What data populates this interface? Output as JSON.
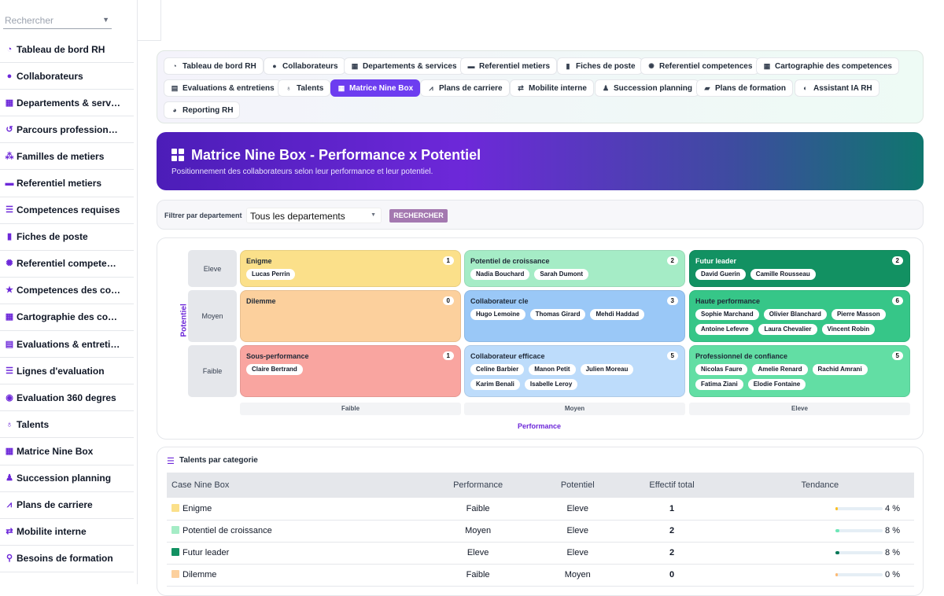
{
  "sidebar": {
    "search_placeholder": "Rechercher",
    "items": [
      {
        "label": "Tableau de bord RH",
        "icon": "gauge-icon"
      },
      {
        "label": "Collaborateurs",
        "icon": "user-icon"
      },
      {
        "label": "Departements & serv…",
        "icon": "building-icon"
      },
      {
        "label": "Parcours profession…",
        "icon": "history-icon"
      },
      {
        "label": "Familles de metiers",
        "icon": "sitemap-icon"
      },
      {
        "label": "Referentiel metiers",
        "icon": "briefcase-icon"
      },
      {
        "label": "Competences requises",
        "icon": "list-icon"
      },
      {
        "label": "Fiches de poste",
        "icon": "file-icon"
      },
      {
        "label": "Referentiel compete…",
        "icon": "gear-icon"
      },
      {
        "label": "Competences des co…",
        "icon": "star-icon"
      },
      {
        "label": "Cartographie des co…",
        "icon": "grid-icon"
      },
      {
        "label": "Evaluations & entreti…",
        "icon": "clipboard-icon"
      },
      {
        "label": "Lignes d'evaluation",
        "icon": "list-icon"
      },
      {
        "label": "Evaluation 360 degres",
        "icon": "comments-icon"
      },
      {
        "label": "Talents",
        "icon": "award-icon"
      },
      {
        "label": "Matrice Nine Box",
        "icon": "grid-icon"
      },
      {
        "label": "Succession planning",
        "icon": "user-tie-icon"
      },
      {
        "label": "Plans de carriere",
        "icon": "route-icon"
      },
      {
        "label": "Mobilite interne",
        "icon": "arrows-icon"
      },
      {
        "label": "Besoins de formation",
        "icon": "lightbulb-icon"
      }
    ]
  },
  "tabs": [
    {
      "label": "Tableau de bord RH",
      "icon": "gauge-icon"
    },
    {
      "label": "Collaborateurs",
      "icon": "user-icon"
    },
    {
      "label": "Departements & services",
      "icon": "building-icon"
    },
    {
      "label": "Referentiel metiers",
      "icon": "briefcase-icon"
    },
    {
      "label": "Fiches de poste",
      "icon": "file-icon"
    },
    {
      "label": "Referentiel competences",
      "icon": "gear-icon"
    },
    {
      "label": "Cartographie des competences",
      "icon": "grid-icon"
    },
    {
      "label": "Evaluations & entretiens",
      "icon": "clipboard-icon"
    },
    {
      "label": "Talents",
      "icon": "award-icon"
    },
    {
      "label": "Matrice Nine Box",
      "icon": "grid-icon",
      "active": true
    },
    {
      "label": "Plans de carriere",
      "icon": "route-icon"
    },
    {
      "label": "Mobilite interne",
      "icon": "arrows-icon"
    },
    {
      "label": "Succession planning",
      "icon": "user-tie-icon"
    },
    {
      "label": "Plans de formation",
      "icon": "graduation-icon"
    },
    {
      "label": "Assistant IA RH",
      "icon": "brain-icon"
    },
    {
      "label": "Reporting RH",
      "icon": "pie-icon"
    }
  ],
  "banner": {
    "title": "Matrice Nine Box - Performance x Potentiel",
    "subtitle": "Positionnement des collaborateurs selon leur performance et leur potentiel."
  },
  "filter": {
    "label": "Filtrer par departement",
    "selected": "Tous les departements",
    "button": "RECHERCHER"
  },
  "matrix": {
    "y_axis_label": "Potentiel",
    "x_axis_label": "Performance",
    "rows": [
      "Eleve",
      "Moyen",
      "Faible"
    ],
    "cols": [
      "Faible",
      "Moyen",
      "Eleve"
    ],
    "cells": [
      {
        "title": "Enigme",
        "count": "1",
        "color": "#fbe08a",
        "people": [
          "Lucas Perrin"
        ]
      },
      {
        "title": "Potentiel de croissance",
        "count": "2",
        "color": "#a5ecc6",
        "people": [
          "Nadia Bouchard",
          "Sarah Dumont"
        ]
      },
      {
        "title": "Futur leader",
        "count": "2",
        "color": "#129162",
        "dark": true,
        "people": [
          "David Guerin",
          "Camille Rousseau"
        ]
      },
      {
        "title": "Dilemme",
        "count": "0",
        "color": "#fcd09d",
        "people": []
      },
      {
        "title": "Collaborateur cle",
        "count": "3",
        "color": "#9ac8f7",
        "people": [
          "Hugo Lemoine",
          "Thomas Girard",
          "Mehdi Haddad"
        ]
      },
      {
        "title": "Haute performance",
        "count": "6",
        "color": "#36c688",
        "people": [
          "Sophie Marchand",
          "Olivier Blanchard",
          "Pierre Masson",
          "Antoine Lefevre",
          "Laura Chevalier",
          "Vincent Robin"
        ]
      },
      {
        "title": "Sous-performance",
        "count": "1",
        "color": "#f9a5a0",
        "people": [
          "Claire Bertrand"
        ]
      },
      {
        "title": "Collaborateur efficace",
        "count": "5",
        "color": "#bddcfb",
        "people": [
          "Celine Barbier",
          "Manon Petit",
          "Julien Moreau",
          "Karim Benali",
          "Isabelle Leroy"
        ]
      },
      {
        "title": "Professionnel de confiance",
        "count": "5",
        "color": "#62dea4",
        "people": [
          "Nicolas Faure",
          "Amelie Renard",
          "Rachid Amrani",
          "Fatima Ziani",
          "Elodie Fontaine"
        ]
      }
    ]
  },
  "table": {
    "title": "Talents par categorie",
    "headers": [
      "Case Nine Box",
      "Performance",
      "Potentiel",
      "Effectif total",
      "Tendance"
    ],
    "rows": [
      {
        "name": "Enigme",
        "color": "#fbe08a",
        "perf": "Faible",
        "pot": "Eleve",
        "total": "1",
        "trend": "4 %",
        "trend_value": 4,
        "bar_color": "#fbbf24"
      },
      {
        "name": "Potentiel de croissance",
        "color": "#a5ecc6",
        "perf": "Moyen",
        "pot": "Eleve",
        "total": "2",
        "trend": "8 %",
        "trend_value": 8,
        "bar_color": "#6ee7b7"
      },
      {
        "name": "Futur leader",
        "color": "#129162",
        "perf": "Eleve",
        "pot": "Eleve",
        "total": "2",
        "trend": "8 %",
        "trend_value": 8,
        "bar_color": "#047857"
      },
      {
        "name": "Dilemme",
        "color": "#fcd09d",
        "perf": "Faible",
        "pot": "Moyen",
        "total": "0",
        "trend": "0 %",
        "trend_value": 0,
        "bar_color": "#fdba74"
      }
    ]
  }
}
